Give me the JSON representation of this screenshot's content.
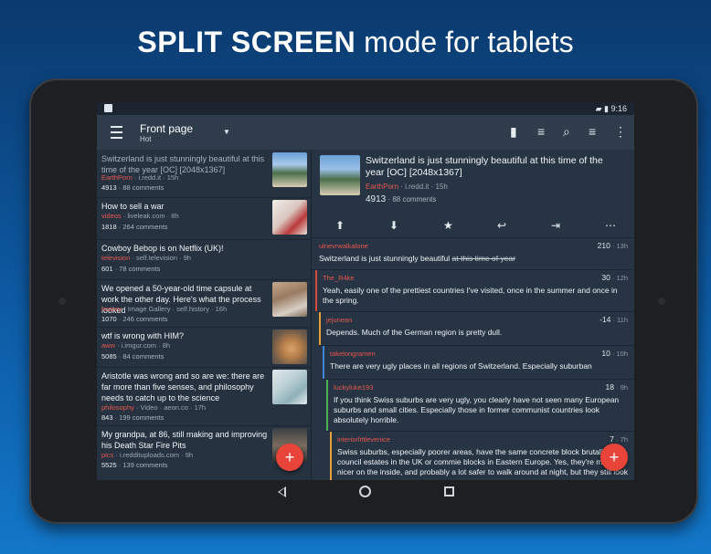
{
  "headline": {
    "bold": "SPLIT SCREEN",
    "light": "mode for tablets"
  },
  "statusbar": {
    "time": "9:16",
    "icons": [
      "signal-icon",
      "battery-icon"
    ]
  },
  "toolbar": {
    "title": "Front page",
    "subtitle": "Hot",
    "icons": [
      "menu-icon",
      "dropdown-icon",
      "view-mode-icon",
      "sort-icon",
      "search-icon",
      "filter-icon",
      "overflow-icon"
    ]
  },
  "posts": [
    {
      "title": "Switzerland is just stunningly beautiful at this time of the year [OC] [2048x1367]",
      "subreddit": "EarthPorn",
      "domain": " · i.redd.it · 15h",
      "score": "4913",
      "comments": " · 88 comments",
      "read": true
    },
    {
      "title": "How to sell a war",
      "subreddit": "videos",
      "domain": " · liveleak.com · 8h",
      "score": "1818",
      "comments": " · 264 comments",
      "read": false
    },
    {
      "title": "Cowboy Bebop is on Netflix (UK)!",
      "subreddit": "television",
      "domain": " · self.television · 9h",
      "score": "601",
      "comments": " · 78 comments",
      "read": false
    },
    {
      "title": "We opened a 50-year-old time capsule at work the other day. Here's what the process looked",
      "subreddit": "history",
      "domain": " · Image Gallery · self.history · 16h",
      "score": "1070",
      "comments": " · 246 comments",
      "read": false
    },
    {
      "title": "wtf is wrong with HIM?",
      "subreddit": "aww",
      "domain": " · i.imgur.com · 8h",
      "score": "5085",
      "comments": " · 84 comments",
      "read": false
    },
    {
      "title": "Aristotle was wrong and so are we: there are far more than five senses, and philosophy needs to catch up to the science",
      "subreddit": "philosophy",
      "domain": " · Video · aeon.co · 17h",
      "score": "843",
      "comments": " · 199 comments",
      "read": false
    },
    {
      "title": "My grandpa, at 86, still making and improving his Death Star Fire Pits",
      "subreddit": "pics",
      "domain": " · i.reddituploads.com · 9h",
      "score": "5525",
      "comments": " · 139 comments",
      "read": false
    }
  ],
  "detail": {
    "title": "Switzerland is just stunningly beautiful at this time of the year [OC] [2048x1367]",
    "subreddit": "EarthPorn",
    "domain": " · i.redd.it · 15h",
    "score": "4913",
    "comments": " · 88 comments",
    "actions": [
      "upvote-icon",
      "downvote-icon",
      "star-icon",
      "reply-icon",
      "open-icon",
      "more-icon"
    ]
  },
  "comments": [
    {
      "author": "ulnevrwalkalone",
      "points": "210",
      "age": " · 13h",
      "body": "Switzerland is just stunningly beautiful ",
      "body_strike": "at this time of year",
      "color": "#e8574f",
      "bar": "#273444"
    },
    {
      "author": "The_R4ke",
      "points": "30",
      "age": " · 12h",
      "body": "Yeah, easily one of the prettiest countries I've visited, once in the summer and once in the spring.",
      "body_strike": "",
      "color": "#e8574f",
      "bar": "#d9463e"
    },
    {
      "author": "jejunean",
      "points": "-14",
      "age": " · 11h",
      "body": "Depends. Much of the German region is pretty dull.",
      "body_strike": "",
      "color": "#e8574f",
      "bar": "#e6a23a"
    },
    {
      "author": "takelongramen",
      "points": "10",
      "age": " · 10h",
      "body": "There are very ugly places in all regions of Switzerland. Especially suburban",
      "body_strike": "",
      "color": "#e8574f",
      "bar": "#3f86d6"
    },
    {
      "author": "luckyluke193",
      "points": "18",
      "age": " · 9h",
      "body": "If you think Swiss suburbs are very ugly, you clearly have not seen many European suburbs and small cities. Especially those in former communist countries look absolutely horrible.",
      "body_strike": "",
      "color": "#e8574f",
      "bar": "#4cb050"
    },
    {
      "author": "interiorlittlevenice",
      "points": "7",
      "age": " · 7h",
      "body": "Swiss suburbs, especially poorer areas, have the same concrete block brutalism as council estates in the UK or commie blocks in Eastern Europe. Yes, they're much nicer on the inside, and probably a lot safer to walk around at night, but they still look",
      "body_strike": "",
      "color": "#e8574f",
      "bar": "#e6a23a"
    }
  ],
  "fab_label": "+",
  "navbar": {
    "icons": [
      "back-icon",
      "home-icon",
      "recents-icon"
    ]
  }
}
